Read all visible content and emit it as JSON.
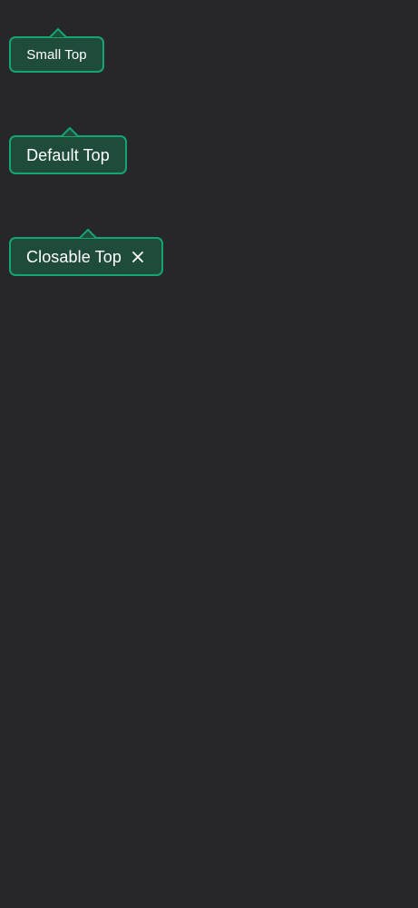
{
  "tooltips": {
    "small": {
      "label": "Small Top"
    },
    "default": {
      "label": "Default Top"
    },
    "closable": {
      "label": "Closable Top",
      "close_icon": "close-icon"
    }
  },
  "colors": {
    "background": "#26262b",
    "tooltip_fill": "#1f4c3a",
    "tooltip_border": "#14a572",
    "text": "#ffffff"
  }
}
